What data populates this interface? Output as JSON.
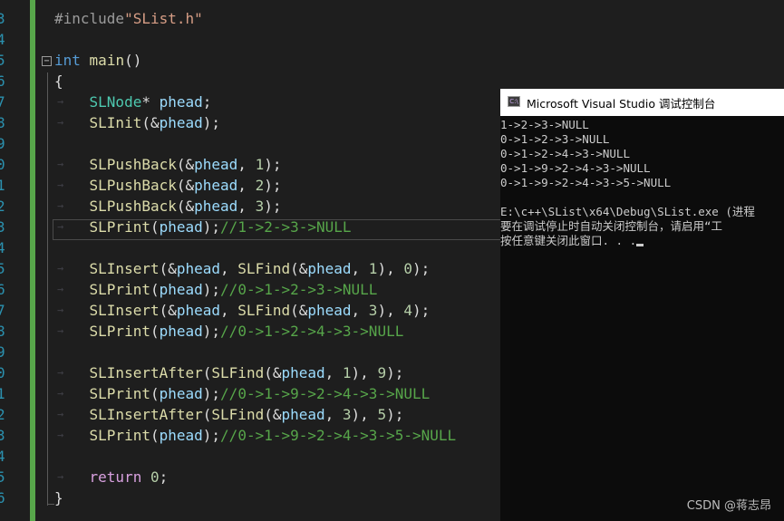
{
  "editor": {
    "line_numbers": [
      "3",
      "4",
      "5",
      "6",
      "7",
      "8",
      "9",
      "0",
      "1",
      "2",
      "3",
      "4",
      "5",
      "6",
      "7",
      "8",
      "9",
      "0",
      "1",
      "2",
      "3",
      "4",
      "5",
      "6"
    ],
    "code_lines": [
      [
        {
          "t": "#include",
          "c": "pp"
        },
        {
          "t": "\"SList.h\"",
          "c": "str"
        }
      ],
      [],
      [
        {
          "t": "int",
          "c": "kw"
        },
        {
          "t": " ",
          "c": "pu"
        },
        {
          "t": "main",
          "c": "fn"
        },
        {
          "t": "()",
          "c": "pu"
        }
      ],
      [
        {
          "t": "{",
          "c": "pu"
        }
      ],
      [
        {
          "t": "    ",
          "c": "pu"
        },
        {
          "t": "SLNode",
          "c": "ty"
        },
        {
          "t": "* ",
          "c": "pu"
        },
        {
          "t": "phead",
          "c": "var"
        },
        {
          "t": ";",
          "c": "pu"
        }
      ],
      [
        {
          "t": "    ",
          "c": "pu"
        },
        {
          "t": "SLInit",
          "c": "fn"
        },
        {
          "t": "(&",
          "c": "pu"
        },
        {
          "t": "phead",
          "c": "var"
        },
        {
          "t": ");",
          "c": "pu"
        }
      ],
      [],
      [
        {
          "t": "    ",
          "c": "pu"
        },
        {
          "t": "SLPushBack",
          "c": "fn"
        },
        {
          "t": "(&",
          "c": "pu"
        },
        {
          "t": "phead",
          "c": "var"
        },
        {
          "t": ", ",
          "c": "pu"
        },
        {
          "t": "1",
          "c": "num"
        },
        {
          "t": ");",
          "c": "pu"
        }
      ],
      [
        {
          "t": "    ",
          "c": "pu"
        },
        {
          "t": "SLPushBack",
          "c": "fn"
        },
        {
          "t": "(&",
          "c": "pu"
        },
        {
          "t": "phead",
          "c": "var"
        },
        {
          "t": ", ",
          "c": "pu"
        },
        {
          "t": "2",
          "c": "num"
        },
        {
          "t": ");",
          "c": "pu"
        }
      ],
      [
        {
          "t": "    ",
          "c": "pu"
        },
        {
          "t": "SLPushBack",
          "c": "fn"
        },
        {
          "t": "(&",
          "c": "pu"
        },
        {
          "t": "phead",
          "c": "var"
        },
        {
          "t": ", ",
          "c": "pu"
        },
        {
          "t": "3",
          "c": "num"
        },
        {
          "t": ");",
          "c": "pu"
        }
      ],
      [
        {
          "t": "    ",
          "c": "pu"
        },
        {
          "t": "SLPrint",
          "c": "fn"
        },
        {
          "t": "(",
          "c": "pu"
        },
        {
          "t": "phead",
          "c": "var"
        },
        {
          "t": ");",
          "c": "pu"
        },
        {
          "t": "//1->2->3->NULL",
          "c": "cm"
        }
      ],
      [],
      [
        {
          "t": "    ",
          "c": "pu"
        },
        {
          "t": "SLInsert",
          "c": "fn"
        },
        {
          "t": "(&",
          "c": "pu"
        },
        {
          "t": "phead",
          "c": "var"
        },
        {
          "t": ", ",
          "c": "pu"
        },
        {
          "t": "SLFind",
          "c": "fn"
        },
        {
          "t": "(&",
          "c": "pu"
        },
        {
          "t": "phead",
          "c": "var"
        },
        {
          "t": ", ",
          "c": "pu"
        },
        {
          "t": "1",
          "c": "num"
        },
        {
          "t": "), ",
          "c": "pu"
        },
        {
          "t": "0",
          "c": "num"
        },
        {
          "t": ");",
          "c": "pu"
        }
      ],
      [
        {
          "t": "    ",
          "c": "pu"
        },
        {
          "t": "SLPrint",
          "c": "fn"
        },
        {
          "t": "(",
          "c": "pu"
        },
        {
          "t": "phead",
          "c": "var"
        },
        {
          "t": ");",
          "c": "pu"
        },
        {
          "t": "//0->1->2->3->NULL",
          "c": "cm"
        }
      ],
      [
        {
          "t": "    ",
          "c": "pu"
        },
        {
          "t": "SLInsert",
          "c": "fn"
        },
        {
          "t": "(&",
          "c": "pu"
        },
        {
          "t": "phead",
          "c": "var"
        },
        {
          "t": ", ",
          "c": "pu"
        },
        {
          "t": "SLFind",
          "c": "fn"
        },
        {
          "t": "(&",
          "c": "pu"
        },
        {
          "t": "phead",
          "c": "var"
        },
        {
          "t": ", ",
          "c": "pu"
        },
        {
          "t": "3",
          "c": "num"
        },
        {
          "t": "), ",
          "c": "pu"
        },
        {
          "t": "4",
          "c": "num"
        },
        {
          "t": ");",
          "c": "pu"
        }
      ],
      [
        {
          "t": "    ",
          "c": "pu"
        },
        {
          "t": "SLPrint",
          "c": "fn"
        },
        {
          "t": "(",
          "c": "pu"
        },
        {
          "t": "phead",
          "c": "var"
        },
        {
          "t": ");",
          "c": "pu"
        },
        {
          "t": "//0->1->2->4->3->NULL",
          "c": "cm"
        }
      ],
      [],
      [
        {
          "t": "    ",
          "c": "pu"
        },
        {
          "t": "SLInsertAfter",
          "c": "fn"
        },
        {
          "t": "(",
          "c": "pu"
        },
        {
          "t": "SLFind",
          "c": "fn"
        },
        {
          "t": "(&",
          "c": "pu"
        },
        {
          "t": "phead",
          "c": "var"
        },
        {
          "t": ", ",
          "c": "pu"
        },
        {
          "t": "1",
          "c": "num"
        },
        {
          "t": "), ",
          "c": "pu"
        },
        {
          "t": "9",
          "c": "num"
        },
        {
          "t": ");",
          "c": "pu"
        }
      ],
      [
        {
          "t": "    ",
          "c": "pu"
        },
        {
          "t": "SLPrint",
          "c": "fn"
        },
        {
          "t": "(",
          "c": "pu"
        },
        {
          "t": "phead",
          "c": "var"
        },
        {
          "t": ");",
          "c": "pu"
        },
        {
          "t": "//0->1->9->2->4->3->NULL",
          "c": "cm"
        }
      ],
      [
        {
          "t": "    ",
          "c": "pu"
        },
        {
          "t": "SLInsertAfter",
          "c": "fn"
        },
        {
          "t": "(",
          "c": "pu"
        },
        {
          "t": "SLFind",
          "c": "fn"
        },
        {
          "t": "(&",
          "c": "pu"
        },
        {
          "t": "phead",
          "c": "var"
        },
        {
          "t": ", ",
          "c": "pu"
        },
        {
          "t": "3",
          "c": "num"
        },
        {
          "t": "), ",
          "c": "pu"
        },
        {
          "t": "5",
          "c": "num"
        },
        {
          "t": ");",
          "c": "pu"
        }
      ],
      [
        {
          "t": "    ",
          "c": "pu"
        },
        {
          "t": "SLPrint",
          "c": "fn"
        },
        {
          "t": "(",
          "c": "pu"
        },
        {
          "t": "phead",
          "c": "var"
        },
        {
          "t": ");",
          "c": "pu"
        },
        {
          "t": "//0->1->9->2->4->3->5->NULL",
          "c": "cm"
        }
      ],
      [],
      [
        {
          "t": "    ",
          "c": "pu"
        },
        {
          "t": "return",
          "c": "ctl"
        },
        {
          "t": " ",
          "c": "pu"
        },
        {
          "t": "0",
          "c": "num"
        },
        {
          "t": ";",
          "c": "pu"
        }
      ],
      [
        {
          "t": "}",
          "c": "pu"
        }
      ]
    ]
  },
  "console": {
    "icon_label": "C:\\",
    "title": "Microsoft Visual Studio 调试控制台",
    "lines": [
      "1->2->3->NULL",
      "0->1->2->3->NULL",
      "0->1->2->4->3->NULL",
      "0->1->9->2->4->3->NULL",
      "0->1->9->2->4->3->5->NULL",
      "",
      "E:\\c++\\SList\\x64\\Debug\\SList.exe (进程",
      "要在调试停止时自动关闭控制台，请启用“工",
      "按任意键关闭此窗口. . ."
    ]
  },
  "watermark": "CSDN @蒋志昂",
  "colors": {
    "editor_bg": "#1e1e1e",
    "line_number": "#2b91af",
    "change_bar": "#57a64a",
    "console_bg": "#0c0c0c"
  }
}
